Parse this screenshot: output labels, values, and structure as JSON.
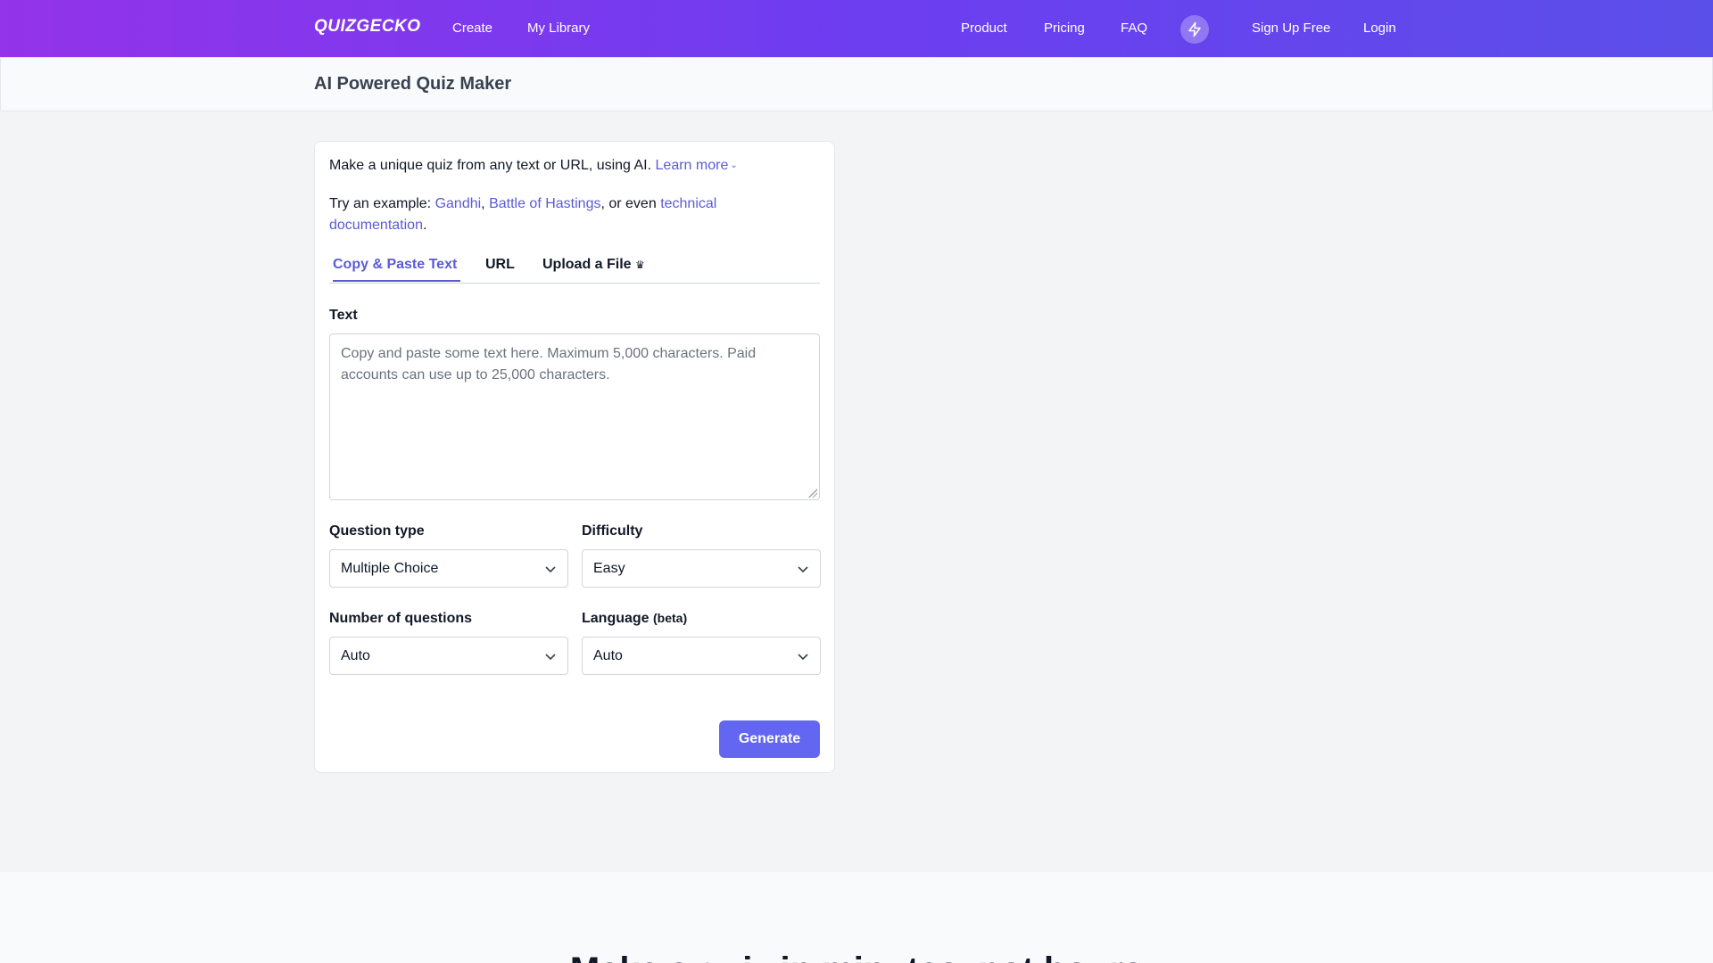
{
  "header": {
    "logo": "QUIZGECKO",
    "nav_left": [
      "Create",
      "My Library"
    ],
    "nav_right": [
      "Product",
      "Pricing",
      "FAQ"
    ],
    "bolt_icon": "lightning-bolt-icon",
    "signup": "Sign Up Free",
    "login": "Login",
    "gradient": [
      "#9333ea",
      "#5b4fe9"
    ]
  },
  "subheader": {
    "title": "AI Powered Quiz Maker"
  },
  "form": {
    "intro_text": "Make a unique quiz from any text or URL, using AI.",
    "learn_more": "Learn more",
    "examples_prefix": "Try an example:",
    "example_1": "Gandhi",
    "example_2": "Battle of Hastings",
    "examples_mid": ", or even",
    "example_3": "technical documentation",
    "tabs": [
      "Copy & Paste Text",
      "URL",
      "Upload a File"
    ],
    "active_tab": "Copy & Paste Text",
    "text_label": "Text",
    "text_placeholder": "Copy and paste some text here. Maximum 5,000 characters. Paid accounts can use up to 25,000 characters.",
    "question_type_label": "Question type",
    "question_type_value": "Multiple Choice",
    "difficulty_label": "Difficulty",
    "difficulty_value": "Easy",
    "num_questions_label": "Number of questions",
    "num_questions_value": "Auto",
    "language_label": "Language",
    "language_note": "(beta)",
    "language_value": "Auto",
    "generate_button": "Generate",
    "accent": "#6366f1"
  },
  "lower_section": {
    "heading_partial": "Make a quiz in minutes, not hours"
  }
}
